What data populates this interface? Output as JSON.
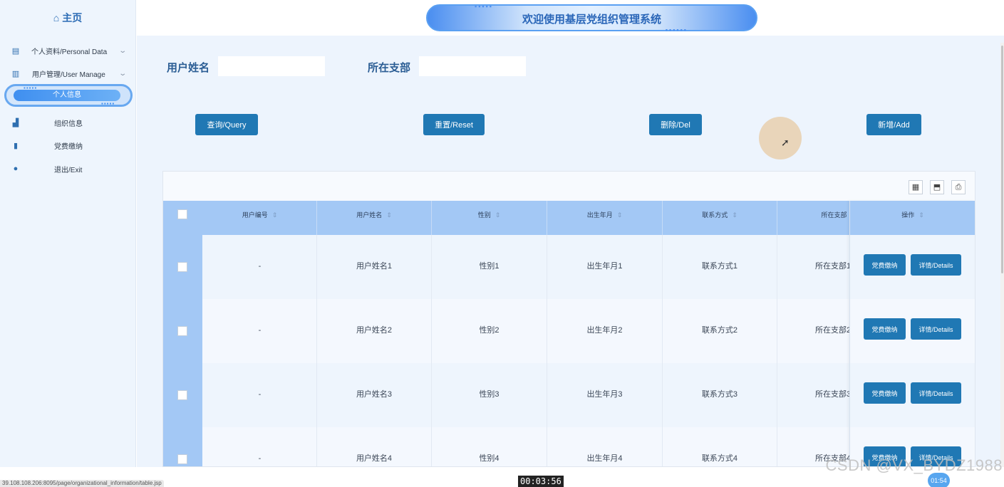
{
  "sidebar": {
    "home": {
      "icon": "home-icon",
      "label": "主页"
    },
    "items": [
      {
        "icon": "document-icon",
        "label": "个人资料/Personal Data",
        "expandable": true
      },
      {
        "icon": "clipboard-icon",
        "label": "用户管理/User Manage",
        "expandable": true
      },
      {
        "icon": "user-icon",
        "label": "个人信息",
        "active": true
      },
      {
        "icon": "bar-chart-icon",
        "label": "组织信息"
      },
      {
        "icon": "bookmark-icon",
        "label": "党费缴纳"
      },
      {
        "icon": "exit-icon",
        "label": "退出/Exit"
      }
    ]
  },
  "header": {
    "title": "欢迎使用基层党组织管理系统"
  },
  "search": {
    "fields": [
      {
        "label": "用户姓名",
        "value": ""
      },
      {
        "label": "所在支部",
        "value": ""
      }
    ],
    "buttons": {
      "query": "查询/Query",
      "reset": "重置/Reset",
      "delete": "删除/Del",
      "add": "新增/Add"
    }
  },
  "table": {
    "toolbar_icons": [
      "columns-icon",
      "export-icon",
      "print-icon"
    ],
    "columns": [
      "用户编号",
      "用户姓名",
      "性别",
      "出生年月",
      "联系方式",
      "所在支部"
    ],
    "ops_header": "操作",
    "rows": [
      [
        "-",
        "用户姓名1",
        "性别1",
        "出生年月1",
        "联系方式1",
        "所在支部1"
      ],
      [
        "-",
        "用户姓名2",
        "性别2",
        "出生年月2",
        "联系方式2",
        "所在支部2"
      ],
      [
        "-",
        "用户姓名3",
        "性别3",
        "出生年月3",
        "联系方式3",
        "所在支部3"
      ],
      [
        "-",
        "用户姓名4",
        "性别4",
        "出生年月4",
        "联系方式4",
        "所在支部4"
      ]
    ],
    "row_actions": {
      "pay": "党费缴纳",
      "details": "详情/Details"
    }
  },
  "overlay": {
    "url": "39.108.108.206:8095/page/organizational_information/table.jsp",
    "timer": "00:03:56",
    "watermark": "CSDN @VX_BYDZ1988",
    "bubble_time": "01:54"
  },
  "colors": {
    "primary_button": "#2078b4",
    "header_row": "#a3c8f5",
    "accent": "#4a8ef0",
    "background": "#edf4fd"
  }
}
